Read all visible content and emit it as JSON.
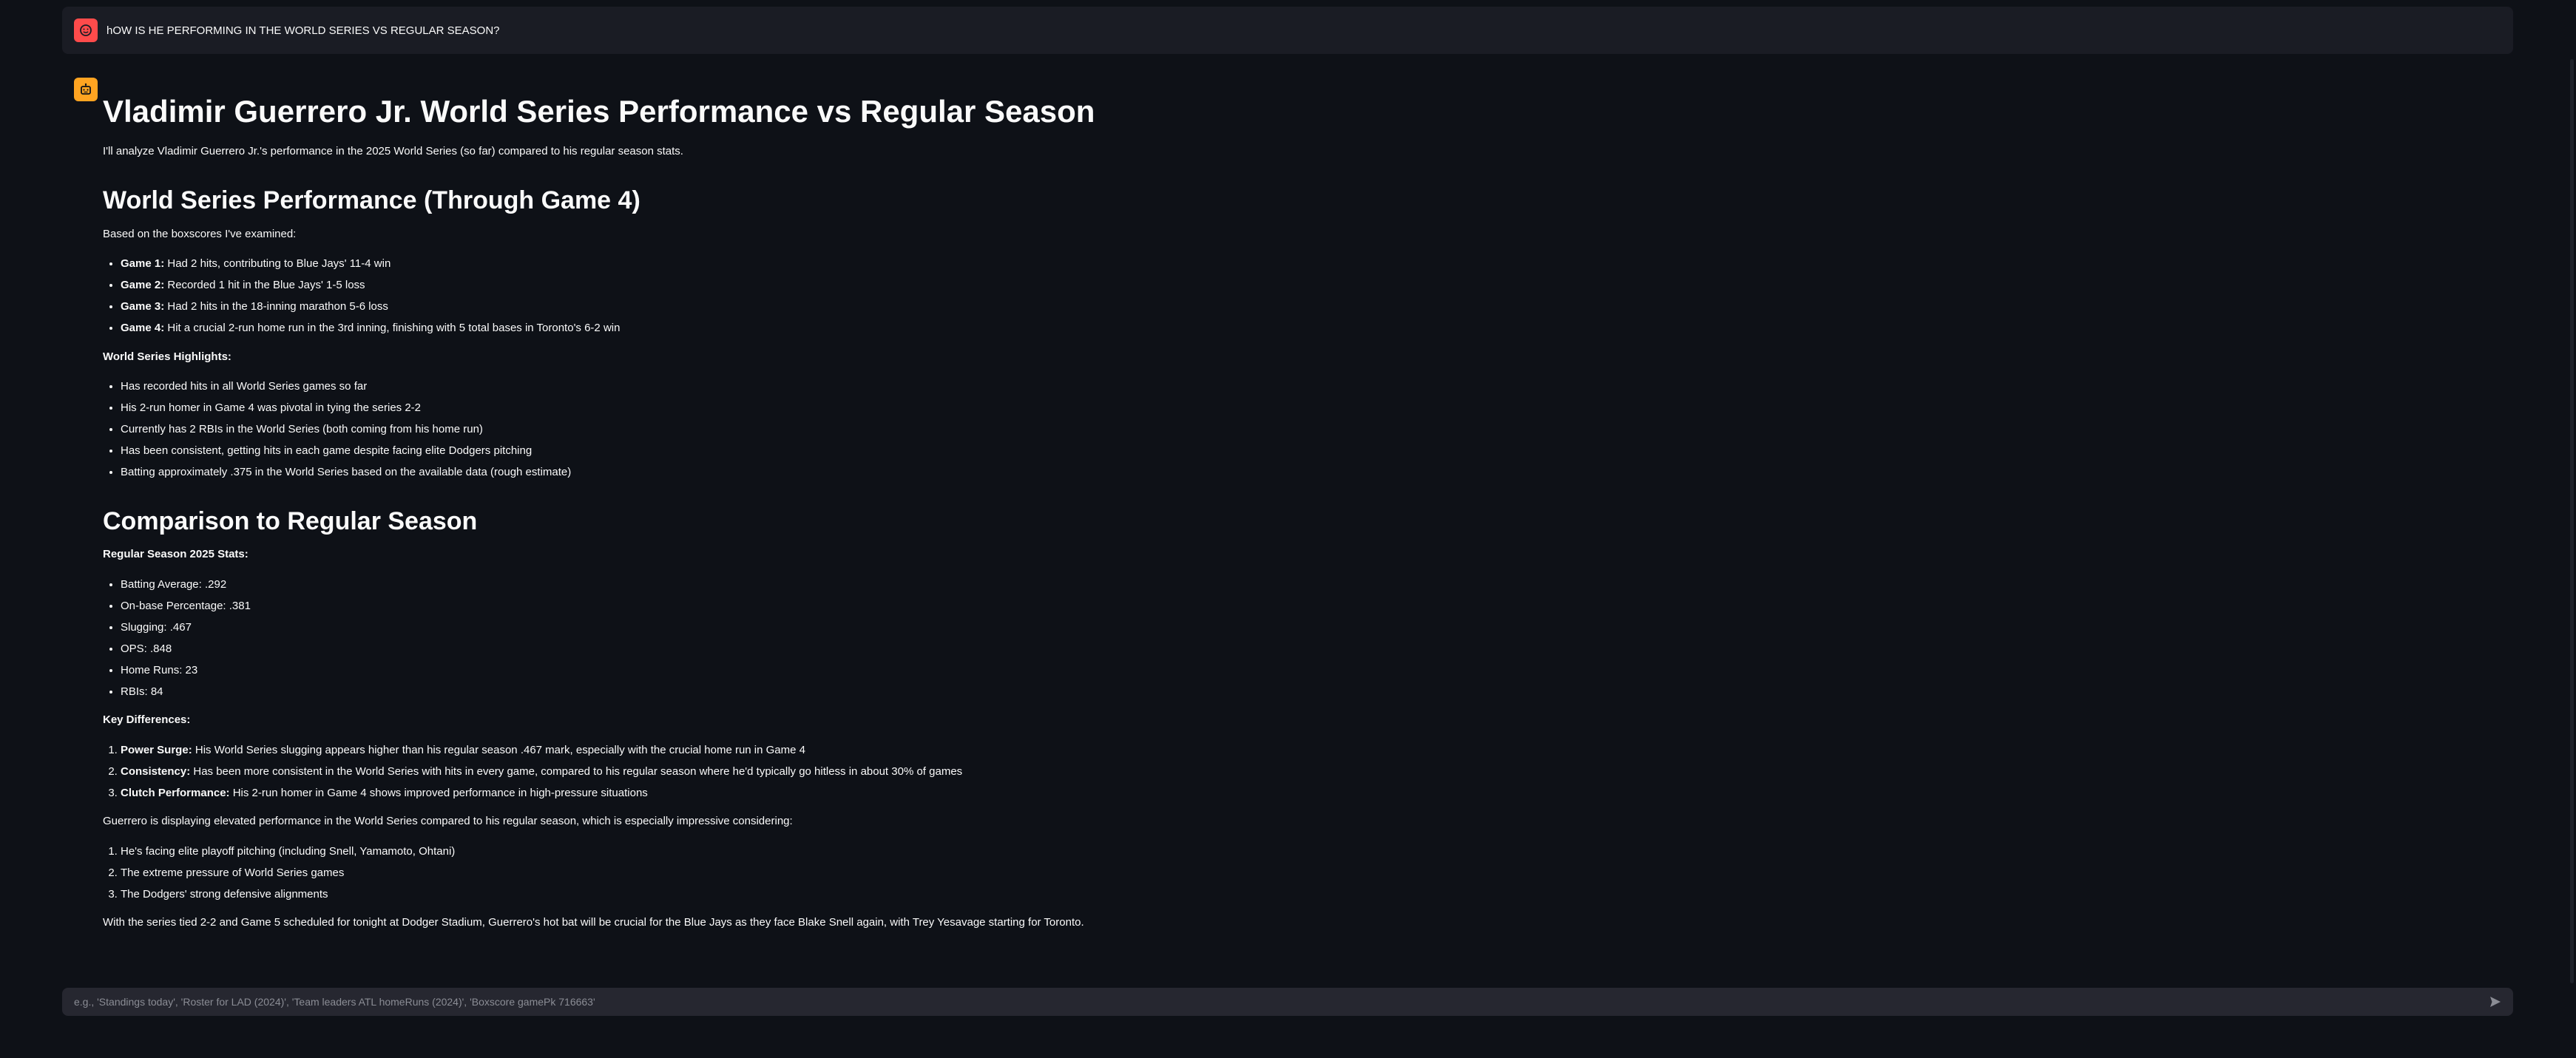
{
  "user_message": {
    "text": "hOW IS HE PERFORMING IN THE WORLD SERIES VS REGULAR SEASON?"
  },
  "assistant": {
    "title": "Vladimir Guerrero Jr. World Series Performance vs Regular Season",
    "intro": "I'll analyze Vladimir Guerrero Jr.'s performance in the 2025 World Series (so far) compared to his regular season stats.",
    "ws_heading": "World Series Performance (Through Game 4)",
    "ws_intro": "Based on the boxscores I've examined:",
    "games": [
      {
        "label": "Game 1:",
        "text": " Had 2 hits, contributing to Blue Jays' 11-4 win"
      },
      {
        "label": "Game 2:",
        "text": " Recorded 1 hit in the Blue Jays' 1-5 loss"
      },
      {
        "label": "Game 3:",
        "text": " Had 2 hits in the 18-inning marathon 5-6 loss"
      },
      {
        "label": "Game 4:",
        "text": " Hit a crucial 2-run home run in the 3rd inning, finishing with 5 total bases in Toronto's 6-2 win"
      }
    ],
    "highlights_heading": "World Series Highlights:",
    "highlights": [
      "Has recorded hits in all World Series games so far",
      "His 2-run homer in Game 4 was pivotal in tying the series 2-2",
      "Currently has 2 RBIs in the World Series (both coming from his home run)",
      "Has been consistent, getting hits in each game despite facing elite Dodgers pitching",
      "Batting approximately .375 in the World Series based on the available data (rough estimate)"
    ],
    "comparison_heading": "Comparison to Regular Season",
    "regular_heading": "Regular Season 2025 Stats:",
    "regular_stats": [
      "Batting Average: .292",
      "On-base Percentage: .381",
      "Slugging: .467",
      "OPS: .848",
      "Home Runs: 23",
      "RBIs: 84"
    ],
    "differences_heading": "Key Differences:",
    "differences": [
      {
        "label": "Power Surge:",
        "text": " His World Series slugging appears higher than his regular season .467 mark, especially with the crucial home run in Game 4"
      },
      {
        "label": "Consistency:",
        "text": " Has been more consistent in the World Series with hits in every game, compared to his regular season where he'd typically go hitless in about 30% of games"
      },
      {
        "label": "Clutch Performance:",
        "text": " His 2-run homer in Game 4 shows improved performance in high-pressure situations"
      }
    ],
    "elevated_text": "Guerrero is displaying elevated performance in the World Series compared to his regular season, which is especially impressive considering:",
    "considerations": [
      "He's facing elite playoff pitching (including Snell, Yamamoto, Ohtani)",
      "The extreme pressure of World Series games",
      "The Dodgers' strong defensive alignments"
    ],
    "closing": "With the series tied 2-2 and Game 5 scheduled for tonight at Dodger Stadium, Guerrero's hot bat will be crucial for the Blue Jays as they face Blake Snell again, with Trey Yesavage starting for Toronto."
  },
  "chat_input": {
    "placeholder": "e.g., 'Standings today', 'Roster for LAD (2024)', 'Team leaders ATL homeRuns (2024)', 'Boxscore gamePk 716663'",
    "value": ""
  },
  "colors": {
    "background": "#0e1117",
    "user_avatar": "#ff4b4b",
    "assistant_avatar": "#ffa421",
    "input_bg": "#262730"
  },
  "icons": {
    "user_avatar": "face-icon",
    "assistant_avatar": "robot-icon",
    "send": "send-icon"
  }
}
